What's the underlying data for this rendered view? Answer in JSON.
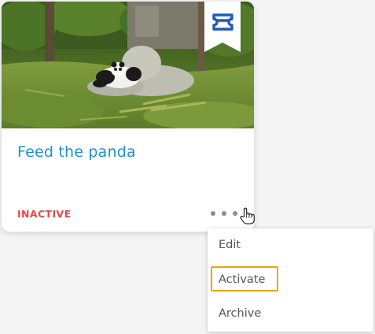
{
  "card": {
    "title": "Feed the panda",
    "status": "INACTIVE",
    "image_icon": "panda-photo",
    "badge_icon": "ticket-icon",
    "more_icon": "more-horizontal-icon",
    "cursor_icon": "hand-pointer-icon"
  },
  "menu": {
    "items": [
      {
        "label": "Edit"
      },
      {
        "label": "Activate",
        "focused": true
      },
      {
        "label": "Archive"
      }
    ]
  },
  "colors": {
    "title": "#1e90d6",
    "status_inactive": "#e24a4a",
    "focus_ring": "#f0a20b",
    "badge": "#1e5bb8",
    "menu_text": "#555555"
  }
}
